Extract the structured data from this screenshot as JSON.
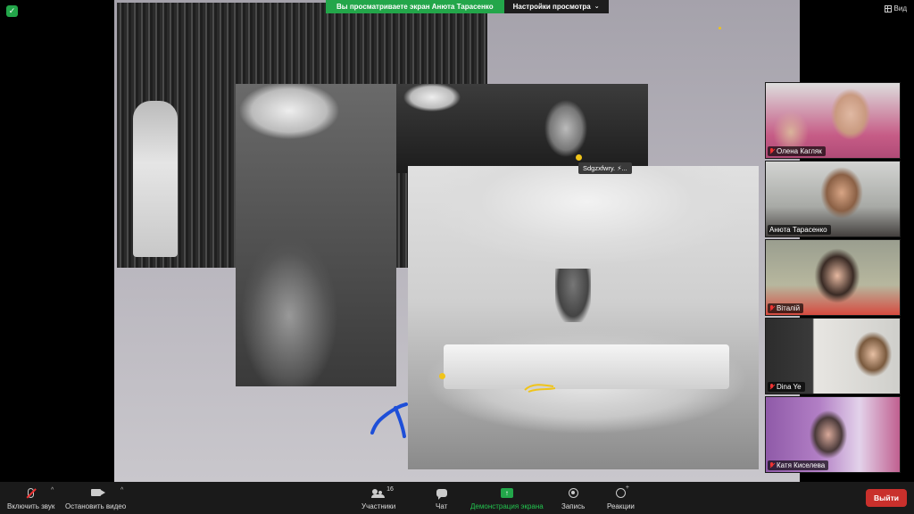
{
  "banner": {
    "viewing_text": "Вы просматриваете экран Анюта Тарасенко",
    "view_options_label": "Настройки просмотра"
  },
  "top_right": {
    "view_label": "Вид"
  },
  "shared_screen": {
    "annotation_caption": "Sdgzxfwry.  ⚡..."
  },
  "participants": [
    {
      "name": "Олена Кагляк",
      "muted": true
    },
    {
      "name": "Анюта Тарасенко",
      "muted": false
    },
    {
      "name": "Віталій",
      "muted": true
    },
    {
      "name": "Dina Ye",
      "muted": true
    },
    {
      "name": "Катя Киселева",
      "muted": true
    }
  ],
  "toolbar": {
    "unmute_label": "Включить звук",
    "start_video_label": "Остановить видео",
    "participants_label": "Участники",
    "participants_count": "16",
    "chat_label": "Чат",
    "share_label": "Демонстрация экрана",
    "record_label": "Запись",
    "reactions_label": "Реакции",
    "leave_label": "Выйти"
  },
  "colors": {
    "accent_green": "#23a64a",
    "leave_red": "#c9302c",
    "annotation_yellow": "#f0c419",
    "annotation_blue": "#1e4fd8"
  }
}
